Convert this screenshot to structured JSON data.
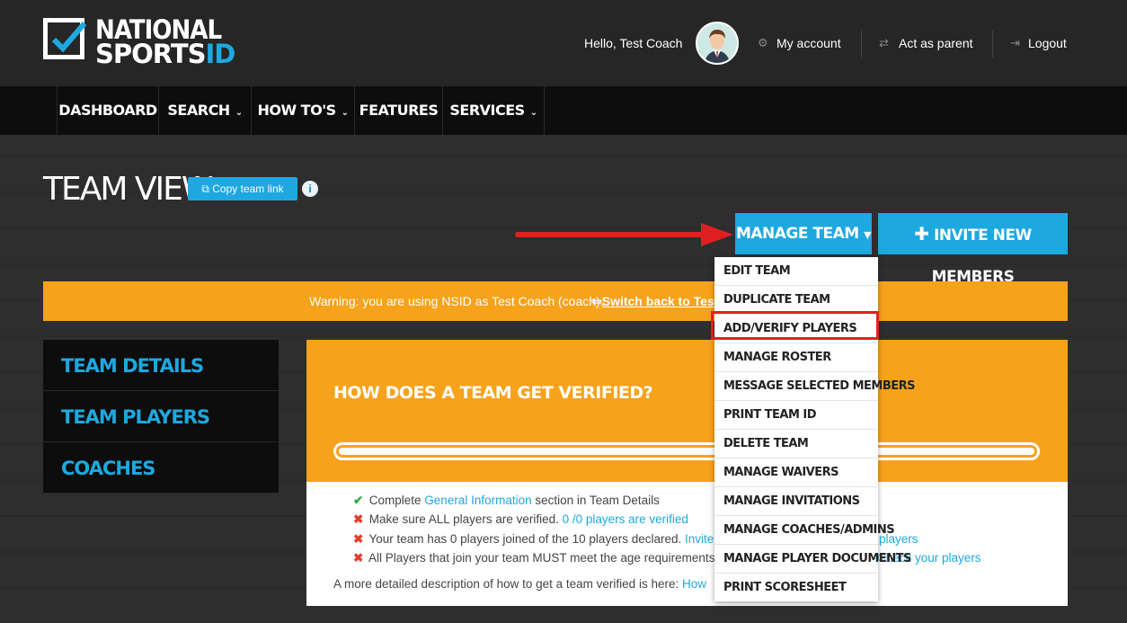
{
  "header": {
    "logo": {
      "line1": "NATIONAL",
      "line2_a": "SPORTS",
      "line2_b": "ID"
    },
    "greeting": "Hello, Test Coach",
    "my_account": "My account",
    "act_as_parent": "Act as parent",
    "logout": "Logout"
  },
  "nav": {
    "items": [
      "DASHBOARD",
      "SEARCH",
      "HOW TO'S",
      "FEATURES",
      "SERVICES"
    ]
  },
  "page": {
    "title": "TEAM VIEW",
    "copy_link": "Copy team link",
    "info": "i"
  },
  "actions": {
    "manage_team": "MANAGE TEAM",
    "invite": "INVITE NEW MEMBERS"
  },
  "warning": {
    "text": "Warning: you are using NSID as Test Coach (coach).",
    "switch_back": "Switch back to Test"
  },
  "side_menu": [
    "TEAM DETAILS",
    "TEAM PLAYERS",
    "COACHES"
  ],
  "verify": {
    "title": "HOW DOES A TEAM GET VERIFIED?",
    "items": [
      {
        "status": "ok",
        "pre": "Complete ",
        "link": "General Information",
        "post": " section in Team Details"
      },
      {
        "status": "no",
        "pre": "Make sure ALL players are verified. ",
        "link": "0 /0 players are verified",
        "post": ""
      },
      {
        "status": "no",
        "pre": "Your team has 0 players joined of the 10 players declared. ",
        "link": "Invite r",
        "post": ""
      },
      {
        "status": "no",
        "pre": "All Players that join your team MUST meet the age requirements",
        "link": "",
        "post": ""
      }
    ],
    "right_link1": "players",
    "right_link2": "Check your players",
    "more_text": "A more detailed description of how to get a team verified is here: ",
    "more_link": "How"
  },
  "dropdown": [
    "EDIT TEAM",
    "DUPLICATE TEAM",
    "ADD/VERIFY PLAYERS",
    "MANAGE ROSTER",
    "MESSAGE SELECTED MEMBERS",
    "PRINT TEAM ID",
    "DELETE TEAM",
    "MANAGE WAIVERS",
    "MANAGE INVITATIONS",
    "MANAGE COACHES/ADMINS",
    "MANAGE PLAYER DOCUMENTS",
    "PRINT SCORESHEET"
  ],
  "colors": {
    "accent": "#1ea8e0",
    "warning": "#f7a21b",
    "highlight": "#e02020"
  }
}
